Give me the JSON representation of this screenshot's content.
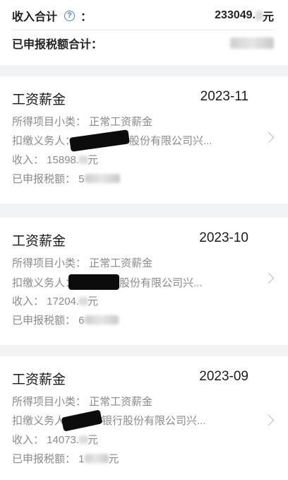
{
  "summary": {
    "income_total_label": "收入合计",
    "help_icon": "question-circle-icon",
    "colon": "：",
    "income_total_value_prefix": "233049.",
    "income_total_value_suffix": "元",
    "tax_total_label": "已申报税额合计："
  },
  "records": [
    {
      "title": "工资薪金",
      "period": "2023-11",
      "subcategory": "所得项目小类： 正常工资薪金",
      "withholder_prefix": "扣缴义务人：",
      "withholder_suffix": "股份有限公司兴...",
      "income_prefix": "收入： 15898.",
      "income_suffix": "元",
      "tax_prefix": "已申报税额： 5"
    },
    {
      "title": "工资薪金",
      "period": "2023-10",
      "subcategory": "所得项目小类： 正常工资薪金",
      "withholder_prefix": "扣缴义务人：",
      "withholder_suffix": "股份有限公司兴...",
      "income_prefix": "收入： 17204.",
      "income_suffix": "元",
      "tax_prefix": "已申报税额： 6"
    },
    {
      "title": "工资薪金",
      "period": "2023-09",
      "subcategory": "所得项目小类： 正常工资薪金",
      "withholder_prefix": "扣缴义务人",
      "withholder_suffix": "银行股份有限公司兴...",
      "income_prefix": "收入： 14073.",
      "income_suffix": "元",
      "tax_prefix": "已申报税额： 1",
      "tax_suffix": "元"
    }
  ],
  "colors": {
    "background": "#f2f3f5",
    "card": "#ffffff",
    "secondary_text": "#8a8a8a",
    "accent": "#4a78d6"
  }
}
